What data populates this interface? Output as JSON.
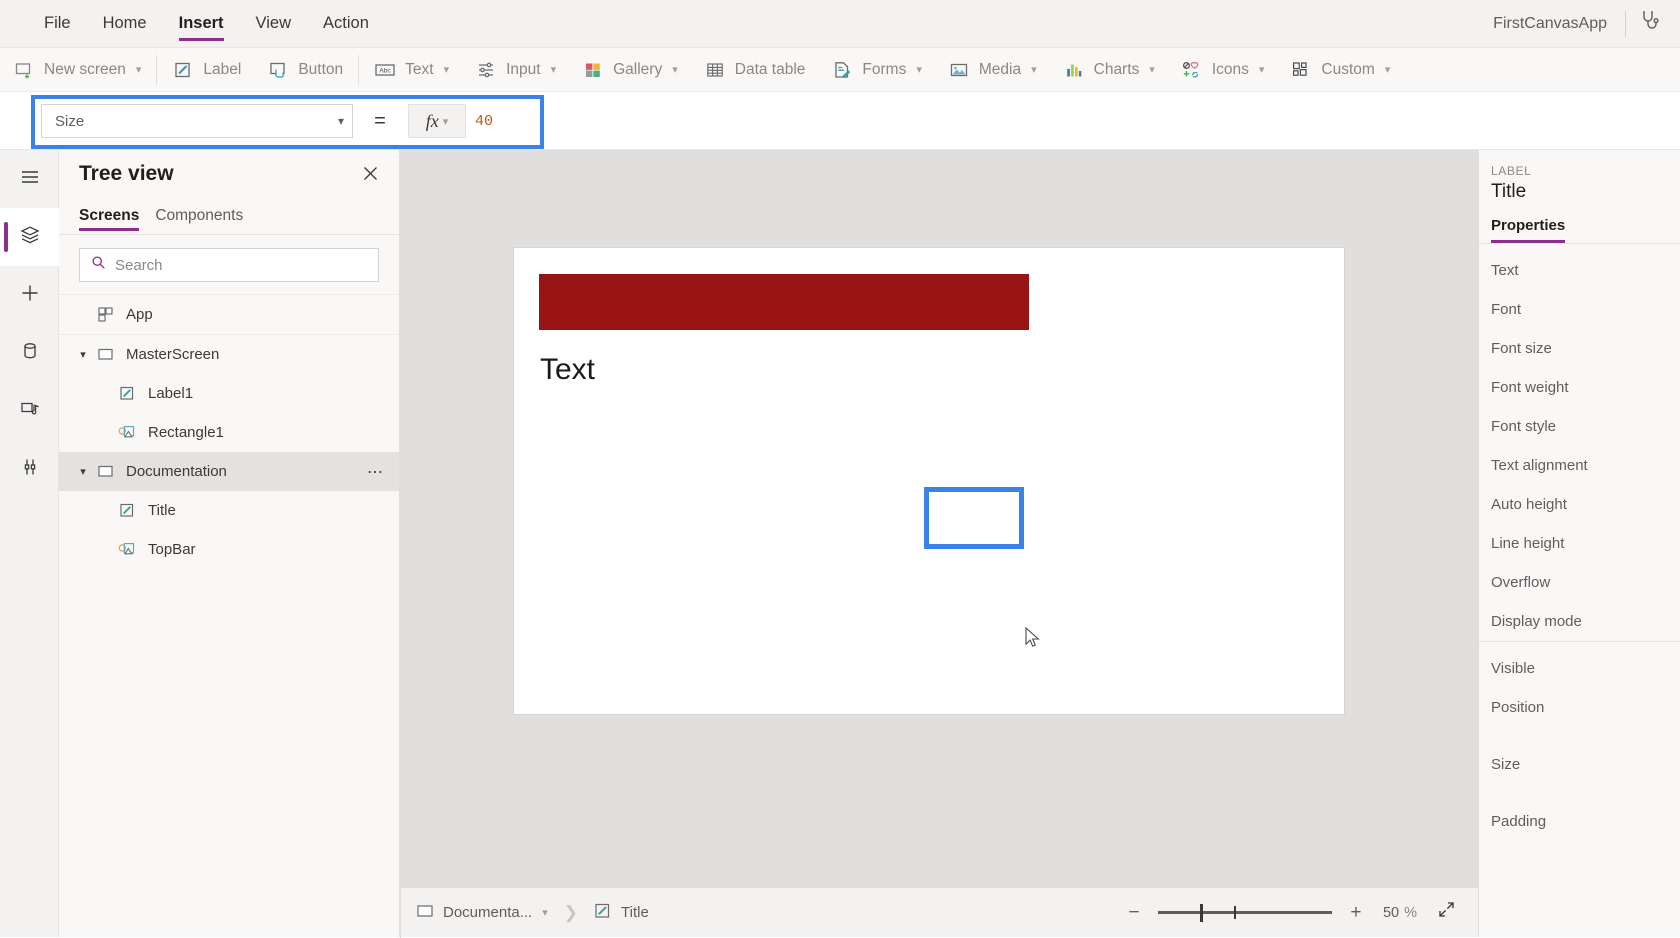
{
  "menubar": {
    "items": [
      {
        "label": "File",
        "active": false
      },
      {
        "label": "Home",
        "active": false
      },
      {
        "label": "Insert",
        "active": true
      },
      {
        "label": "View",
        "active": false
      },
      {
        "label": "Action",
        "active": false
      }
    ],
    "app_name": "FirstCanvasApp",
    "checker_icon": "stethoscope-icon"
  },
  "ribbon": {
    "buttons": [
      {
        "label": "New screen",
        "icon": "new-screen-icon",
        "caret": true
      },
      {
        "label": "Label",
        "icon": "label-icon",
        "caret": false
      },
      {
        "label": "Button",
        "icon": "button-icon",
        "caret": false
      },
      {
        "label": "Text",
        "icon": "text-icon",
        "caret": true
      },
      {
        "label": "Input",
        "icon": "input-icon",
        "caret": true
      },
      {
        "label": "Gallery",
        "icon": "gallery-icon",
        "caret": true
      },
      {
        "label": "Data table",
        "icon": "data-table-icon",
        "caret": false
      },
      {
        "label": "Forms",
        "icon": "forms-icon",
        "caret": true
      },
      {
        "label": "Media",
        "icon": "media-icon",
        "caret": true
      },
      {
        "label": "Charts",
        "icon": "charts-icon",
        "caret": true
      },
      {
        "label": "Icons",
        "icon": "icons-icon",
        "caret": true
      },
      {
        "label": "Custom",
        "icon": "custom-icon",
        "caret": true
      }
    ]
  },
  "formula_bar": {
    "property_name": "Size",
    "equals": "=",
    "fx_label": "fx",
    "value": "40",
    "value_color": "#c55a11",
    "highlight_color": "#3b82e8"
  },
  "rail": {
    "items": [
      {
        "icon": "hamburger-menu-icon",
        "selected": false
      },
      {
        "icon": "tree-view-layers-icon",
        "selected": true
      },
      {
        "icon": "insert-plus-icon",
        "selected": false
      },
      {
        "icon": "data-cylinder-icon",
        "selected": false
      },
      {
        "icon": "media-library-icon",
        "selected": false
      },
      {
        "icon": "advanced-tools-icon",
        "selected": false
      }
    ]
  },
  "tree_view": {
    "title": "Tree view",
    "close_icon": "close-icon",
    "tabs": [
      {
        "label": "Screens",
        "active": true
      },
      {
        "label": "Components",
        "active": false
      }
    ],
    "search": {
      "placeholder": "Search",
      "icon": "search-icon",
      "value": ""
    },
    "nodes": [
      {
        "label": "App",
        "icon": "app-grid-icon",
        "indent": "lvl0-noexp",
        "expandable": false,
        "highlight": false,
        "ellipsis": false
      },
      {
        "label": "MasterScreen",
        "icon": "screen-icon",
        "indent": "lvl0",
        "expandable": true,
        "highlight": false,
        "ellipsis": false
      },
      {
        "label": "Label1",
        "icon": "label-node-icon",
        "indent": "lvl1",
        "expandable": false,
        "highlight": false,
        "ellipsis": false
      },
      {
        "label": "Rectangle1",
        "icon": "shape-node-icon",
        "indent": "lvl1",
        "expandable": false,
        "highlight": false,
        "ellipsis": false
      },
      {
        "label": "Documentation",
        "icon": "screen-icon",
        "indent": "lvl0",
        "expandable": true,
        "highlight": true,
        "ellipsis": true
      },
      {
        "label": "Title",
        "icon": "label-node-icon",
        "indent": "lvl1",
        "expandable": false,
        "highlight": false,
        "ellipsis": false
      },
      {
        "label": "TopBar",
        "icon": "shape-node-icon",
        "indent": "lvl1",
        "expandable": false,
        "highlight": false,
        "ellipsis": false
      }
    ]
  },
  "canvas": {
    "rect_color": "#981313",
    "label_text": "Text",
    "selection_color": "#3b82e8",
    "background": "#ffffff"
  },
  "status_bar": {
    "screen_chip": "Documenta...",
    "screen_icon": "screen-icon",
    "control_chip": "Title",
    "control_icon": "label-node-icon",
    "zoom_out_label": "−",
    "zoom_in_label": "+",
    "zoom_value": "50",
    "zoom_unit": "%",
    "fit_icon": "fit-screen-icon"
  },
  "properties_panel": {
    "kicker": "LABEL",
    "control_name": "Title",
    "tab_label": "Properties",
    "group_one": [
      "Text",
      "Font",
      "Font size",
      "Font weight",
      "Font style",
      "Text alignment",
      "Auto height",
      "Line height",
      "Overflow",
      "Display mode"
    ],
    "group_two": [
      "Visible",
      "Position",
      "Size",
      "Padding"
    ]
  }
}
